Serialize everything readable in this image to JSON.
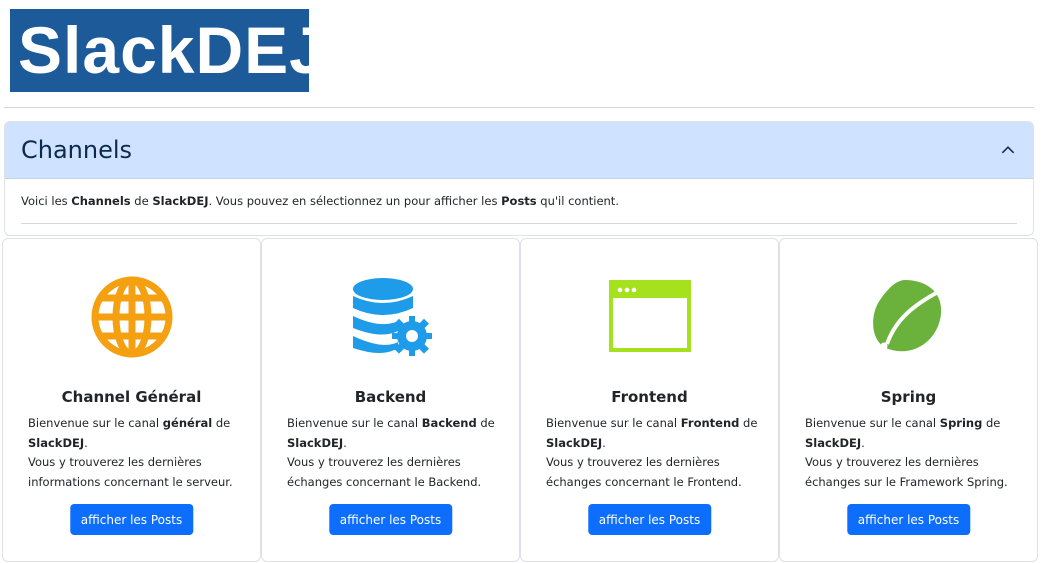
{
  "logo": {
    "text": "SlackDEJ"
  },
  "accordion": {
    "title": "Channels",
    "intro": {
      "p1": "Voici les ",
      "b1": "Channels",
      "p2": " de ",
      "b2": "SlackDEJ",
      "p3": ". Vous pouvez en sélectionnez un pour afficher les ",
      "b3": "Posts",
      "p4": " qu'il contient."
    }
  },
  "cards": [
    {
      "title": "Channel Général",
      "intro": "Bienvenue sur le canal ",
      "bold": "général",
      "suffix": " de",
      "site": "SlackDEJ",
      "dot": ".",
      "line2": "Vous y trouverez les dernières informations concernant le serveur.",
      "button": "afficher les Posts",
      "icon": "globe-icon",
      "color": "#f5a010"
    },
    {
      "title": "Backend",
      "intro": "Bienvenue sur le canal ",
      "bold": "Backend",
      "suffix": " de",
      "site": "SlackDEJ",
      "dot": ".",
      "line2": "Vous y trouverez les dernières échanges concernant le Backend.",
      "button": "afficher les Posts",
      "icon": "database-gear-icon",
      "color": "#1e9be9"
    },
    {
      "title": "Frontend",
      "intro": "Bienvenue sur le canal ",
      "bold": "Frontend",
      "suffix": " de",
      "site": "SlackDEJ",
      "dot": ".",
      "line2": "Vous y trouverez les dernières échanges concernant le Frontend.",
      "button": "afficher les Posts",
      "icon": "browser-window-icon",
      "color": "#a5e21d"
    },
    {
      "title": "Spring",
      "intro": "Bienvenue sur le canal ",
      "bold": "Spring",
      "suffix": " de",
      "site": "SlackDEJ",
      "dot": ".",
      "line2": "Vous y trouverez les dernières échanges sur le Framework Spring.",
      "button": "afficher les Posts",
      "icon": "spring-leaf-icon",
      "color": "#6ab23c"
    }
  ],
  "colors": {
    "primary": "#0d6efd",
    "accordion_header": "#cfe2ff",
    "logo_bg": "#1d5a99"
  }
}
